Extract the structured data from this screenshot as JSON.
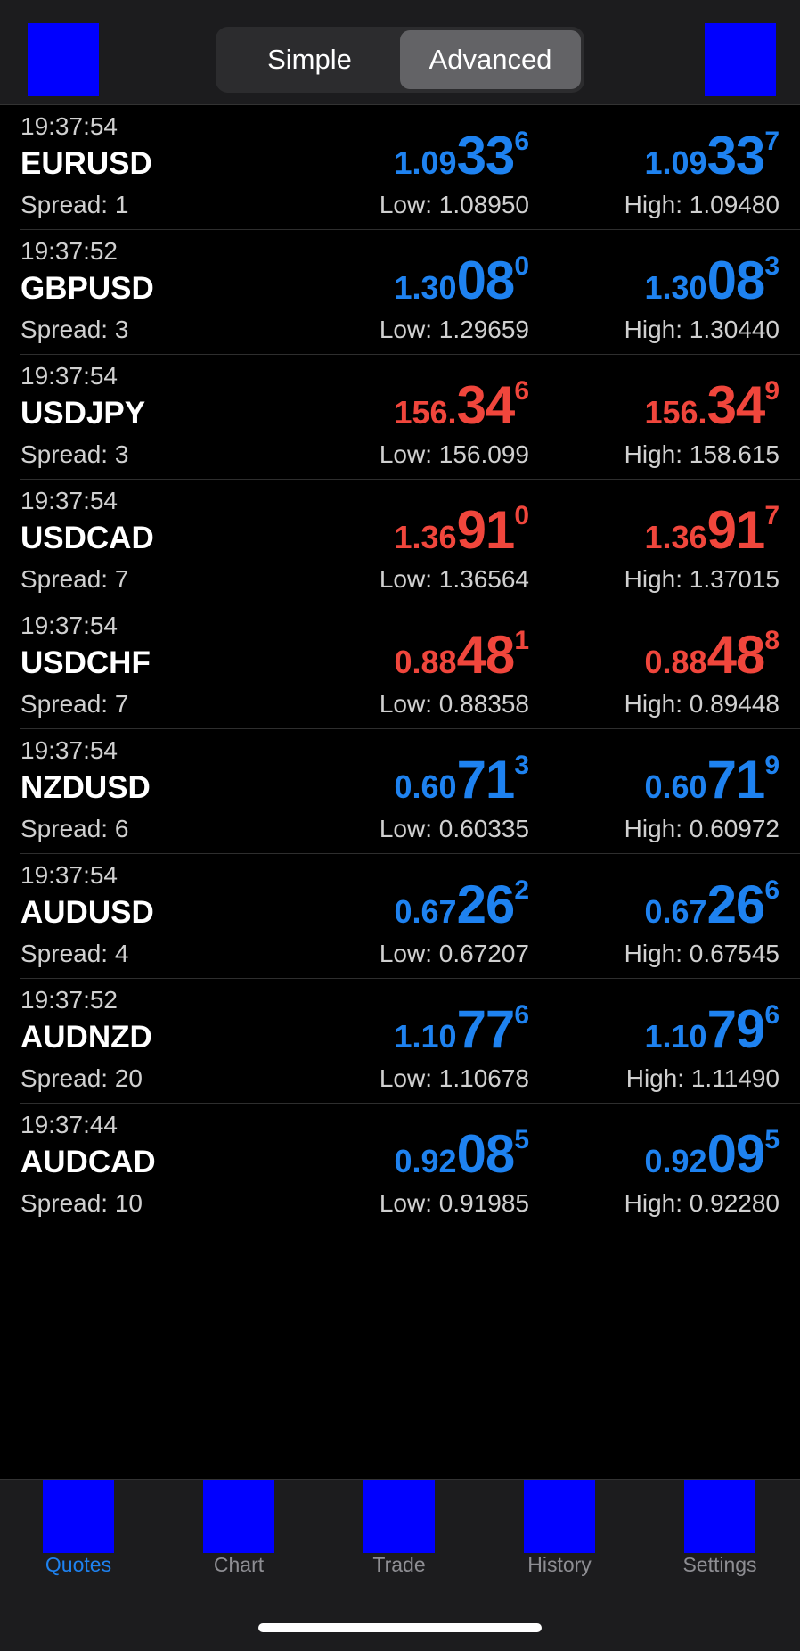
{
  "header": {
    "left_icon": "square-icon",
    "right_icon": "square-icon",
    "segments": [
      {
        "label": "Simple",
        "active": false
      },
      {
        "label": "Advanced",
        "active": true
      }
    ]
  },
  "colors": {
    "up": "#1e82f0",
    "down": "#f0463c"
  },
  "quotes": [
    {
      "time": "19:37:54",
      "symbol": "EURUSD",
      "spread": "Spread: 1",
      "direction": "up",
      "bid": {
        "pre": "1.09",
        "big": "33",
        "sup": "6"
      },
      "ask": {
        "pre": "1.09",
        "big": "33",
        "sup": "7"
      },
      "low": "Low: 1.08950",
      "high": "High: 1.09480"
    },
    {
      "time": "19:37:52",
      "symbol": "GBPUSD",
      "spread": "Spread: 3",
      "direction": "up",
      "bid": {
        "pre": "1.30",
        "big": "08",
        "sup": "0"
      },
      "ask": {
        "pre": "1.30",
        "big": "08",
        "sup": "3"
      },
      "low": "Low: 1.29659",
      "high": "High: 1.30440"
    },
    {
      "time": "19:37:54",
      "symbol": "USDJPY",
      "spread": "Spread: 3",
      "direction": "down",
      "bid": {
        "pre": "156.",
        "big": "34",
        "sup": "6"
      },
      "ask": {
        "pre": "156.",
        "big": "34",
        "sup": "9"
      },
      "low": "Low: 156.099",
      "high": "High: 158.615"
    },
    {
      "time": "19:37:54",
      "symbol": "USDCAD",
      "spread": "Spread: 7",
      "direction": "down",
      "bid": {
        "pre": "1.36",
        "big": "91",
        "sup": "0"
      },
      "ask": {
        "pre": "1.36",
        "big": "91",
        "sup": "7"
      },
      "low": "Low: 1.36564",
      "high": "High: 1.37015"
    },
    {
      "time": "19:37:54",
      "symbol": "USDCHF",
      "spread": "Spread: 7",
      "direction": "down",
      "bid": {
        "pre": "0.88",
        "big": "48",
        "sup": "1"
      },
      "ask": {
        "pre": "0.88",
        "big": "48",
        "sup": "8"
      },
      "low": "Low: 0.88358",
      "high": "High: 0.89448"
    },
    {
      "time": "19:37:54",
      "symbol": "NZDUSD",
      "spread": "Spread: 6",
      "direction": "up",
      "bid": {
        "pre": "0.60",
        "big": "71",
        "sup": "3"
      },
      "ask": {
        "pre": "0.60",
        "big": "71",
        "sup": "9"
      },
      "low": "Low: 0.60335",
      "high": "High: 0.60972"
    },
    {
      "time": "19:37:54",
      "symbol": "AUDUSD",
      "spread": "Spread: 4",
      "direction": "up",
      "bid": {
        "pre": "0.67",
        "big": "26",
        "sup": "2"
      },
      "ask": {
        "pre": "0.67",
        "big": "26",
        "sup": "6"
      },
      "low": "Low: 0.67207",
      "high": "High: 0.67545"
    },
    {
      "time": "19:37:52",
      "symbol": "AUDNZD",
      "spread": "Spread: 20",
      "direction": "up",
      "bid": {
        "pre": "1.10",
        "big": "77",
        "sup": "6"
      },
      "ask": {
        "pre": "1.10",
        "big": "79",
        "sup": "6"
      },
      "low": "Low: 1.10678",
      "high": "High: 1.11490"
    },
    {
      "time": "19:37:44",
      "symbol": "AUDCAD",
      "spread": "Spread: 10",
      "direction": "up",
      "bid": {
        "pre": "0.92",
        "big": "08",
        "sup": "5"
      },
      "ask": {
        "pre": "0.92",
        "big": "09",
        "sup": "5"
      },
      "low": "Low: 0.91985",
      "high": "High: 0.92280"
    }
  ],
  "tabbar": {
    "items": [
      {
        "label": "Quotes",
        "icon": "quotes-icon",
        "active": true
      },
      {
        "label": "Chart",
        "icon": "chart-icon",
        "active": false
      },
      {
        "label": "Trade",
        "icon": "trade-icon",
        "active": false
      },
      {
        "label": "History",
        "icon": "history-icon",
        "active": false
      },
      {
        "label": "Settings",
        "icon": "settings-icon",
        "active": false
      }
    ]
  }
}
